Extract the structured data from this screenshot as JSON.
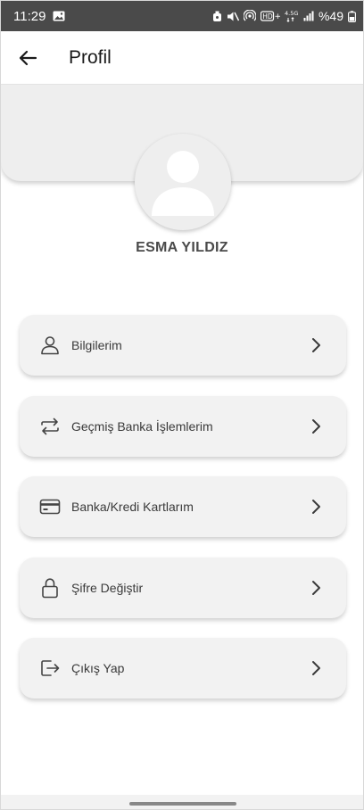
{
  "status_bar": {
    "time": "11:29",
    "network": "4.5G",
    "battery": "%49"
  },
  "app_bar": {
    "title": "Profil"
  },
  "profile": {
    "name": "ESMA YILDIZ"
  },
  "menu": [
    {
      "label": "Bilgilerim",
      "icon": "user-icon"
    },
    {
      "label": "Geçmiş Banka İşlemlerim",
      "icon": "transfer-icon"
    },
    {
      "label": "Banka/Kredi Kartlarım",
      "icon": "credit-card-icon"
    },
    {
      "label": "Şifre Değiştir",
      "icon": "lock-icon"
    },
    {
      "label": "Çıkış Yap",
      "icon": "logout-icon"
    }
  ],
  "colors": {
    "status_bar_bg": "#4a4a4a",
    "card_bg": "#f2f2f2",
    "header_bg": "#eeeeee",
    "text": "#3a3a3a"
  }
}
